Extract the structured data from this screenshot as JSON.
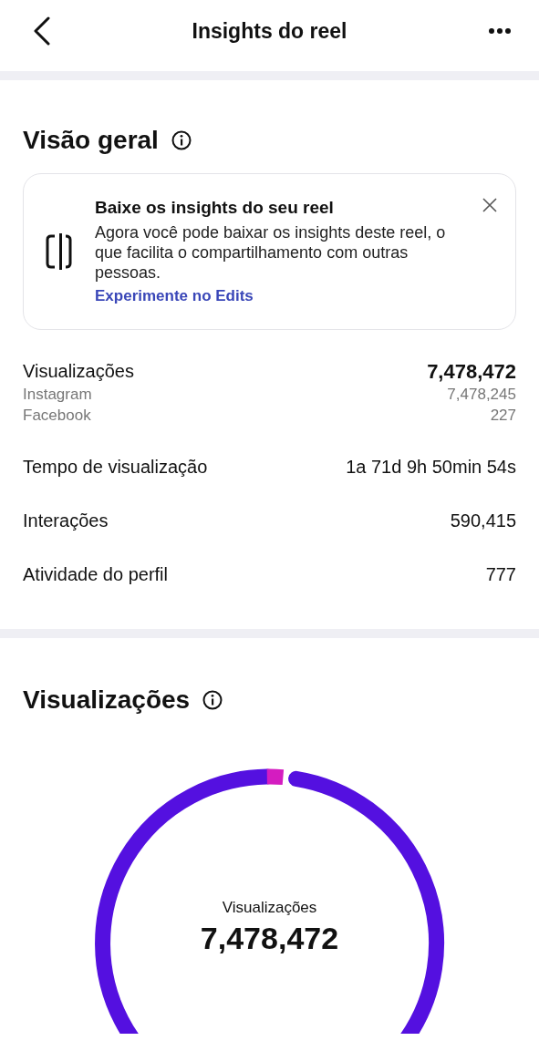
{
  "header": {
    "title": "Insights do reel"
  },
  "overview": {
    "title": "Visão geral",
    "card": {
      "title": "Baixe os insights do seu reel",
      "body": "Agora você pode baixar os insights deste reel, o que facilita o compartilhamento com outras pessoas.",
      "link": "Experimente no Edits"
    },
    "metrics": [
      {
        "label": "Visualizações",
        "value": "7,478,472",
        "bold": true,
        "breakdown": [
          {
            "label": "Instagram",
            "value": "7,478,245"
          },
          {
            "label": "Facebook",
            "value": "227"
          }
        ]
      },
      {
        "label": "Tempo de visualização",
        "value": "1a 71d 9h 50min 54s",
        "bold": false
      },
      {
        "label": "Interações",
        "value": "590,415",
        "bold": false
      },
      {
        "label": "Atividade do perfil",
        "value": "777",
        "bold": false
      }
    ]
  },
  "views": {
    "title": "Visualizações",
    "center_label": "Visualizações",
    "center_value": "7,478,472"
  }
}
